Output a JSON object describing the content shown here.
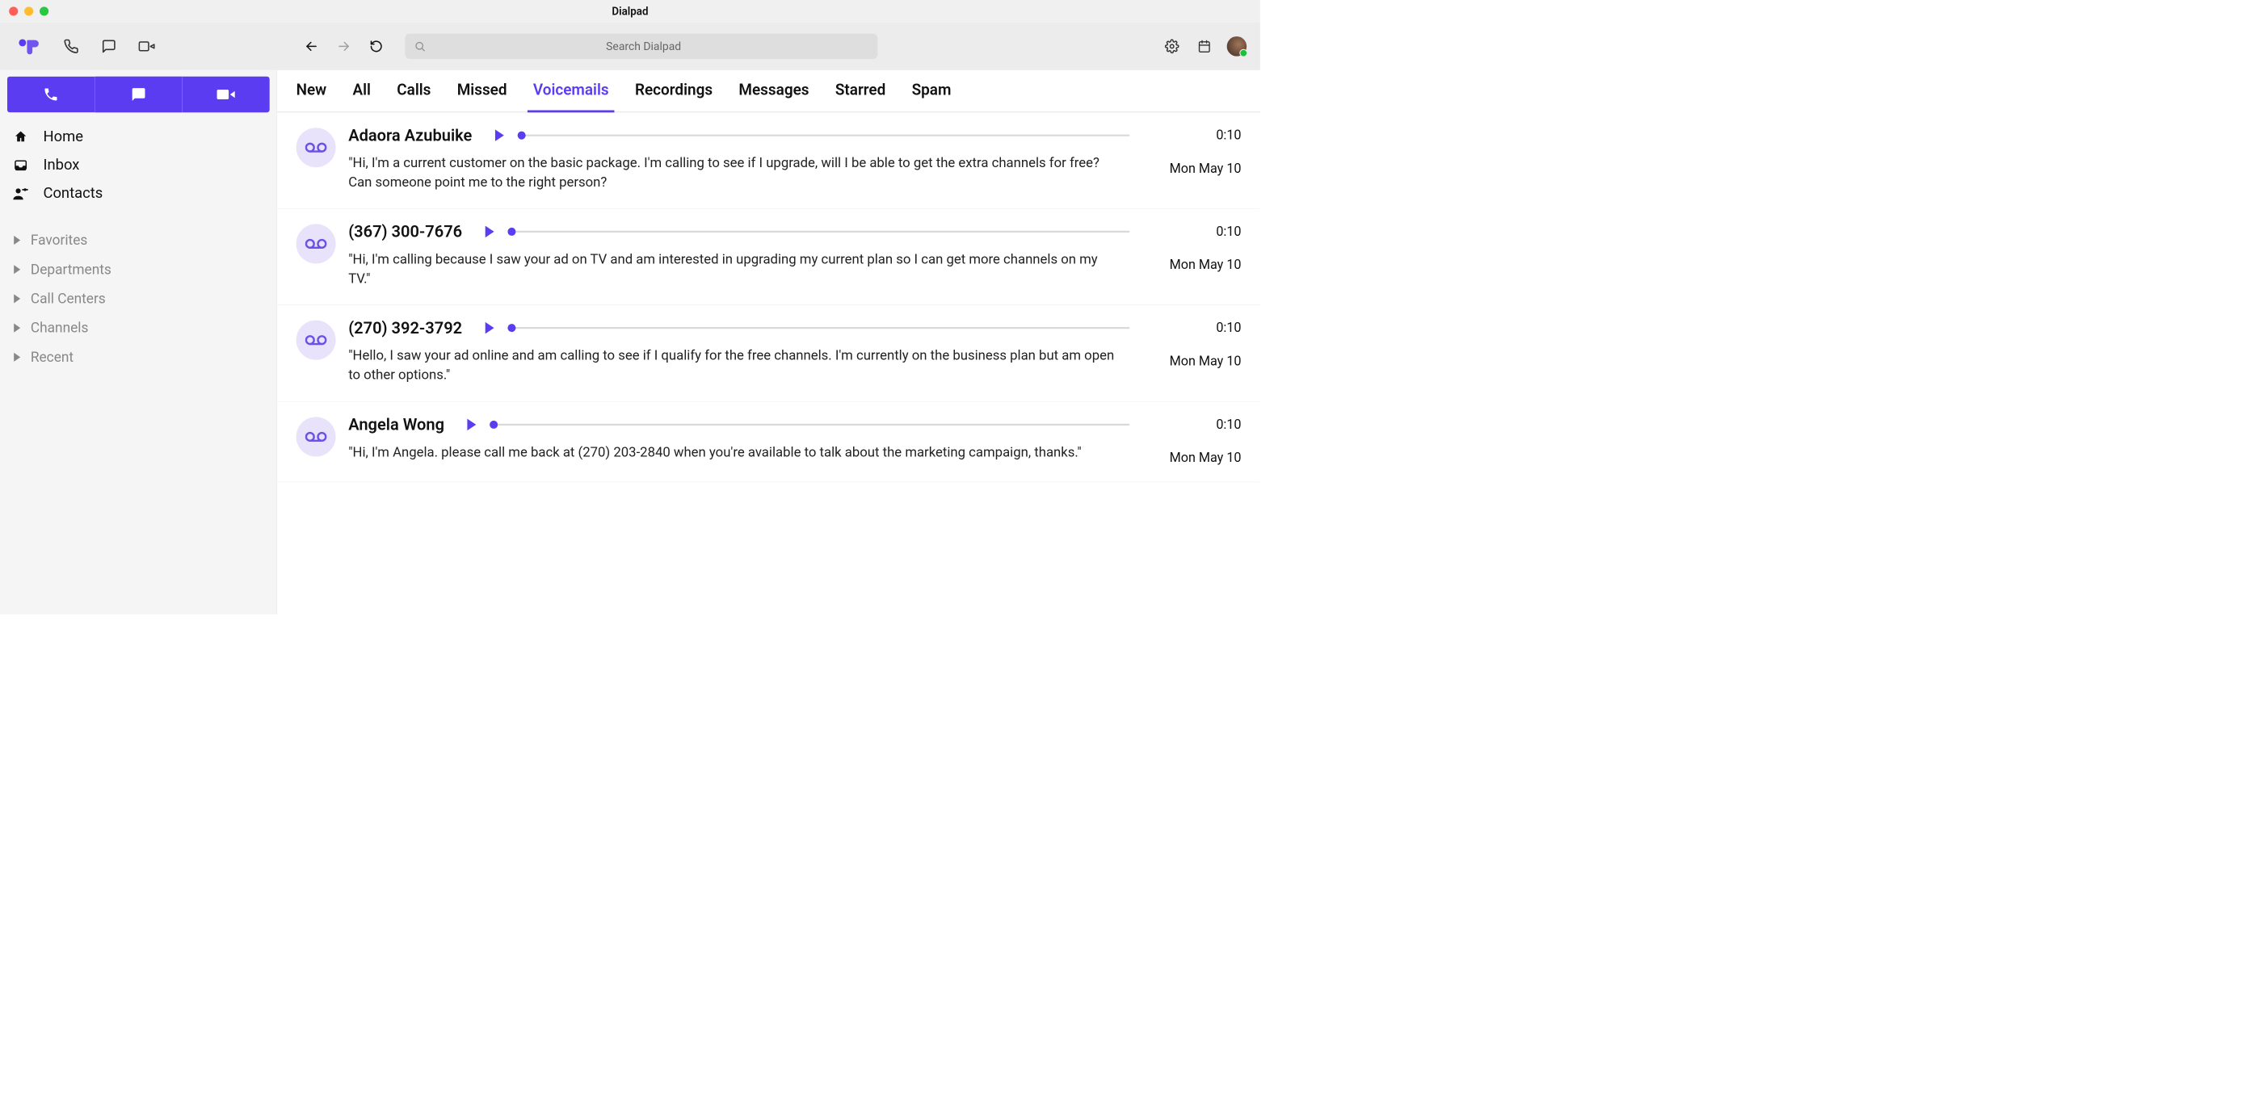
{
  "window": {
    "title": "Dialpad"
  },
  "topbar": {
    "search_placeholder": "Search Dialpad"
  },
  "sidebar": {
    "primary": [
      {
        "icon": "home",
        "label": "Home"
      },
      {
        "icon": "inbox",
        "label": "Inbox"
      },
      {
        "icon": "contacts",
        "label": "Contacts"
      }
    ],
    "sections": [
      {
        "label": "Favorites"
      },
      {
        "label": "Departments"
      },
      {
        "label": "Call Centers"
      },
      {
        "label": "Channels"
      },
      {
        "label": "Recent"
      }
    ]
  },
  "tabs": [
    {
      "label": "New",
      "active": false
    },
    {
      "label": "All",
      "active": false
    },
    {
      "label": "Calls",
      "active": false
    },
    {
      "label": "Missed",
      "active": false
    },
    {
      "label": "Voicemails",
      "active": true
    },
    {
      "label": "Recordings",
      "active": false
    },
    {
      "label": "Messages",
      "active": false
    },
    {
      "label": "Starred",
      "active": false
    },
    {
      "label": "Spam",
      "active": false
    }
  ],
  "voicemails": [
    {
      "caller": "Adaora Azubuike",
      "duration": "0:10",
      "date": "Mon May 10",
      "transcript": "\"Hi, I'm a current customer on the basic package. I'm calling to see if I upgrade, will I be able to get the extra channels for free? Can someone point me to the right person?"
    },
    {
      "caller": "(367) 300-7676",
      "duration": "0:10",
      "date": "Mon May 10",
      "transcript": "\"Hi, I'm calling because I saw your ad on TV and am interested in upgrading my current plan so I can get more channels on my TV.\""
    },
    {
      "caller": "(270) 392-3792",
      "duration": "0:10",
      "date": "Mon May 10",
      "transcript": "\"Hello, I saw your ad online and am calling to see if I qualify for the free channels. I'm currently on the business plan but am open to other options.\""
    },
    {
      "caller": "Angela Wong",
      "duration": "0:10",
      "date": "Mon May 10",
      "transcript": "\"Hi, I'm Angela. please call me back at (270) 203-2840 when you're available to talk about the marketing campaign, thanks.\""
    }
  ]
}
